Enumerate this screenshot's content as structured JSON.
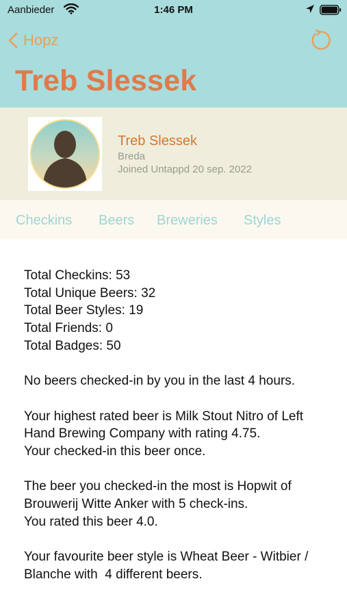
{
  "status_bar": {
    "carrier": "Aanbieder",
    "time": "1:46 PM"
  },
  "nav": {
    "back_label": "Hopz",
    "title": "Treb Slessek"
  },
  "profile": {
    "name": "Treb Slessek",
    "city": "Breda",
    "joined": "Joined Untappd 20 sep. 2022"
  },
  "tabs": [
    {
      "label": "Checkins"
    },
    {
      "label": "Beers"
    },
    {
      "label": "Breweries"
    },
    {
      "label": "Styles"
    }
  ],
  "stats": {
    "total_checkins": "Total Checkins: 53",
    "total_unique_beers": "Total Unique Beers: 32",
    "total_beer_styles": "Total Beer Styles: 19",
    "total_friends": "Total Friends: 0",
    "total_badges": "Total Badges: 50"
  },
  "paragraphs": {
    "recent": "No beers checked-in by you in the last 4 hours.",
    "highest_rated": "Your highest rated beer is Milk Stout Nitro of Left Hand Brewing Company with rating 4.75.",
    "highest_rated_count": "Your checked-in this beer once.",
    "most_checked": "The beer you checked-in the most is Hopwit of Brouwerij Witte Anker with 5 check-ins.",
    "most_checked_rating": "You rated this beer 4.0.",
    "favourite_style": "Your favourite beer style is Wheat Beer - Witbier / Blanche with  4 different beers."
  },
  "colors": {
    "header_bg": "#a9dcdc",
    "accent_orange": "#e07a4a",
    "profile_bg": "#efeedd",
    "tab_text": "#9fd4d4"
  },
  "icons": [
    "wifi-icon",
    "location-arrow-icon",
    "battery-icon",
    "chevron-left-icon",
    "refresh-icon",
    "avatar-silhouette-icon"
  ]
}
